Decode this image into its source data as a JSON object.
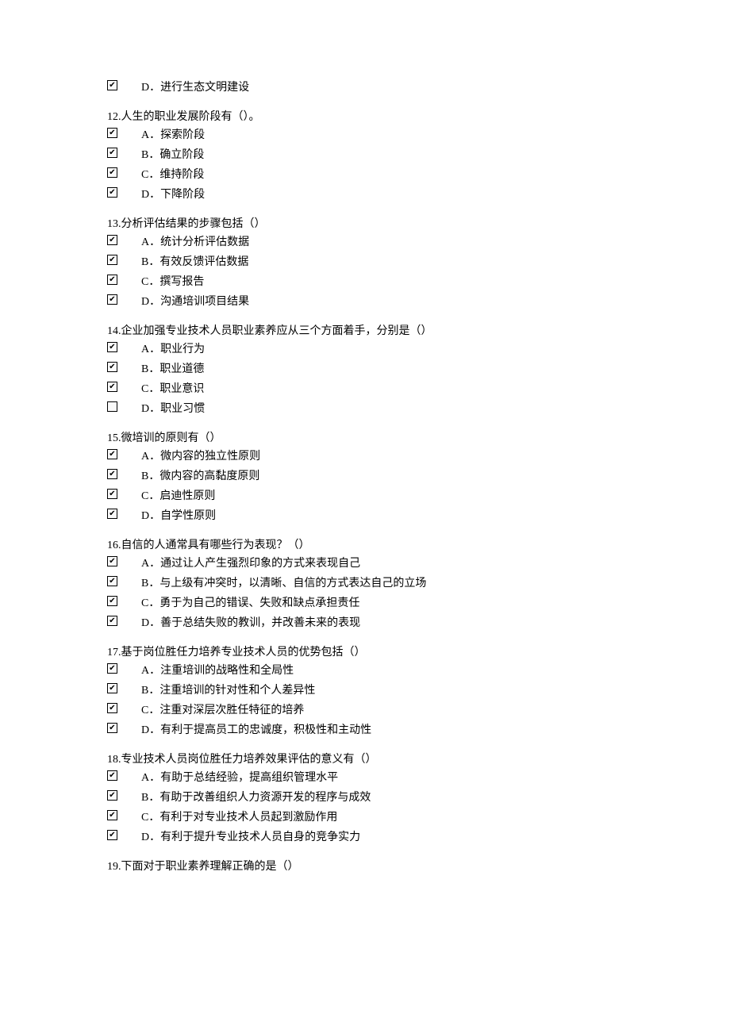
{
  "leadingOption": {
    "checked": true,
    "label": "D．进行生态文明建设"
  },
  "questions": [
    {
      "number": "12.",
      "text": "人生的职业发展阶段有（）。",
      "options": [
        {
          "checked": true,
          "label": "A．探索阶段"
        },
        {
          "checked": true,
          "label": "B．确立阶段"
        },
        {
          "checked": true,
          "label": "C．维持阶段"
        },
        {
          "checked": true,
          "label": "D．下降阶段"
        }
      ]
    },
    {
      "number": "13.",
      "text": "分析评估结果的步骤包括（）",
      "options": [
        {
          "checked": true,
          "label": "A．统计分析评估数据"
        },
        {
          "checked": true,
          "label": "B．有效反馈评估数据"
        },
        {
          "checked": true,
          "label": "C．撰写报告"
        },
        {
          "checked": true,
          "label": "D．沟通培训项目结果"
        }
      ]
    },
    {
      "number": "14.",
      "text": "企业加强专业技术人员职业素养应从三个方面着手，分别是（）",
      "options": [
        {
          "checked": true,
          "label": "A．职业行为"
        },
        {
          "checked": true,
          "label": "B．职业道德"
        },
        {
          "checked": true,
          "label": "C．职业意识"
        },
        {
          "checked": false,
          "label": "D．职业习惯"
        }
      ]
    },
    {
      "number": "15.",
      "text": "微培训的原则有（）",
      "options": [
        {
          "checked": true,
          "label": "A．微内容的独立性原则"
        },
        {
          "checked": true,
          "label": "B．微内容的高黏度原则"
        },
        {
          "checked": true,
          "label": "C．启迪性原则"
        },
        {
          "checked": true,
          "label": "D．自学性原则"
        }
      ]
    },
    {
      "number": "16.",
      "text": "自信的人通常具有哪些行为表现？（）",
      "options": [
        {
          "checked": true,
          "label": "A．通过让人产生强烈印象的方式来表现自己"
        },
        {
          "checked": true,
          "label": "B．与上级有冲突时，以清晰、自信的方式表达自己的立场"
        },
        {
          "checked": true,
          "label": "C．勇于为自己的错误、失败和缺点承担责任"
        },
        {
          "checked": true,
          "label": "D．善于总结失败的教训，并改善未来的表现"
        }
      ]
    },
    {
      "number": "17.",
      "text": "基于岗位胜任力培养专业技术人员的优势包括（）",
      "options": [
        {
          "checked": true,
          "label": "A．注重培训的战略性和全局性"
        },
        {
          "checked": true,
          "label": "B．注重培训的针对性和个人差异性"
        },
        {
          "checked": true,
          "label": "C．注重对深层次胜任特征的培养"
        },
        {
          "checked": true,
          "label": "D．有利于提高员工的忠诚度，积极性和主动性"
        }
      ]
    },
    {
      "number": "18.",
      "text": "专业技术人员岗位胜任力培养效果评估的意义有（）",
      "options": [
        {
          "checked": true,
          "label": "A．有助于总结经验，提高组织管理水平"
        },
        {
          "checked": true,
          "label": "B．有助于改善组织人力资源开发的程序与成效"
        },
        {
          "checked": true,
          "label": "C．有利于对专业技术人员起到激励作用"
        },
        {
          "checked": true,
          "label": "D．有利于提升专业技术人员自身的竞争实力"
        }
      ]
    },
    {
      "number": "19.",
      "text": "下面对于职业素养理解正确的是（）",
      "options": []
    }
  ]
}
